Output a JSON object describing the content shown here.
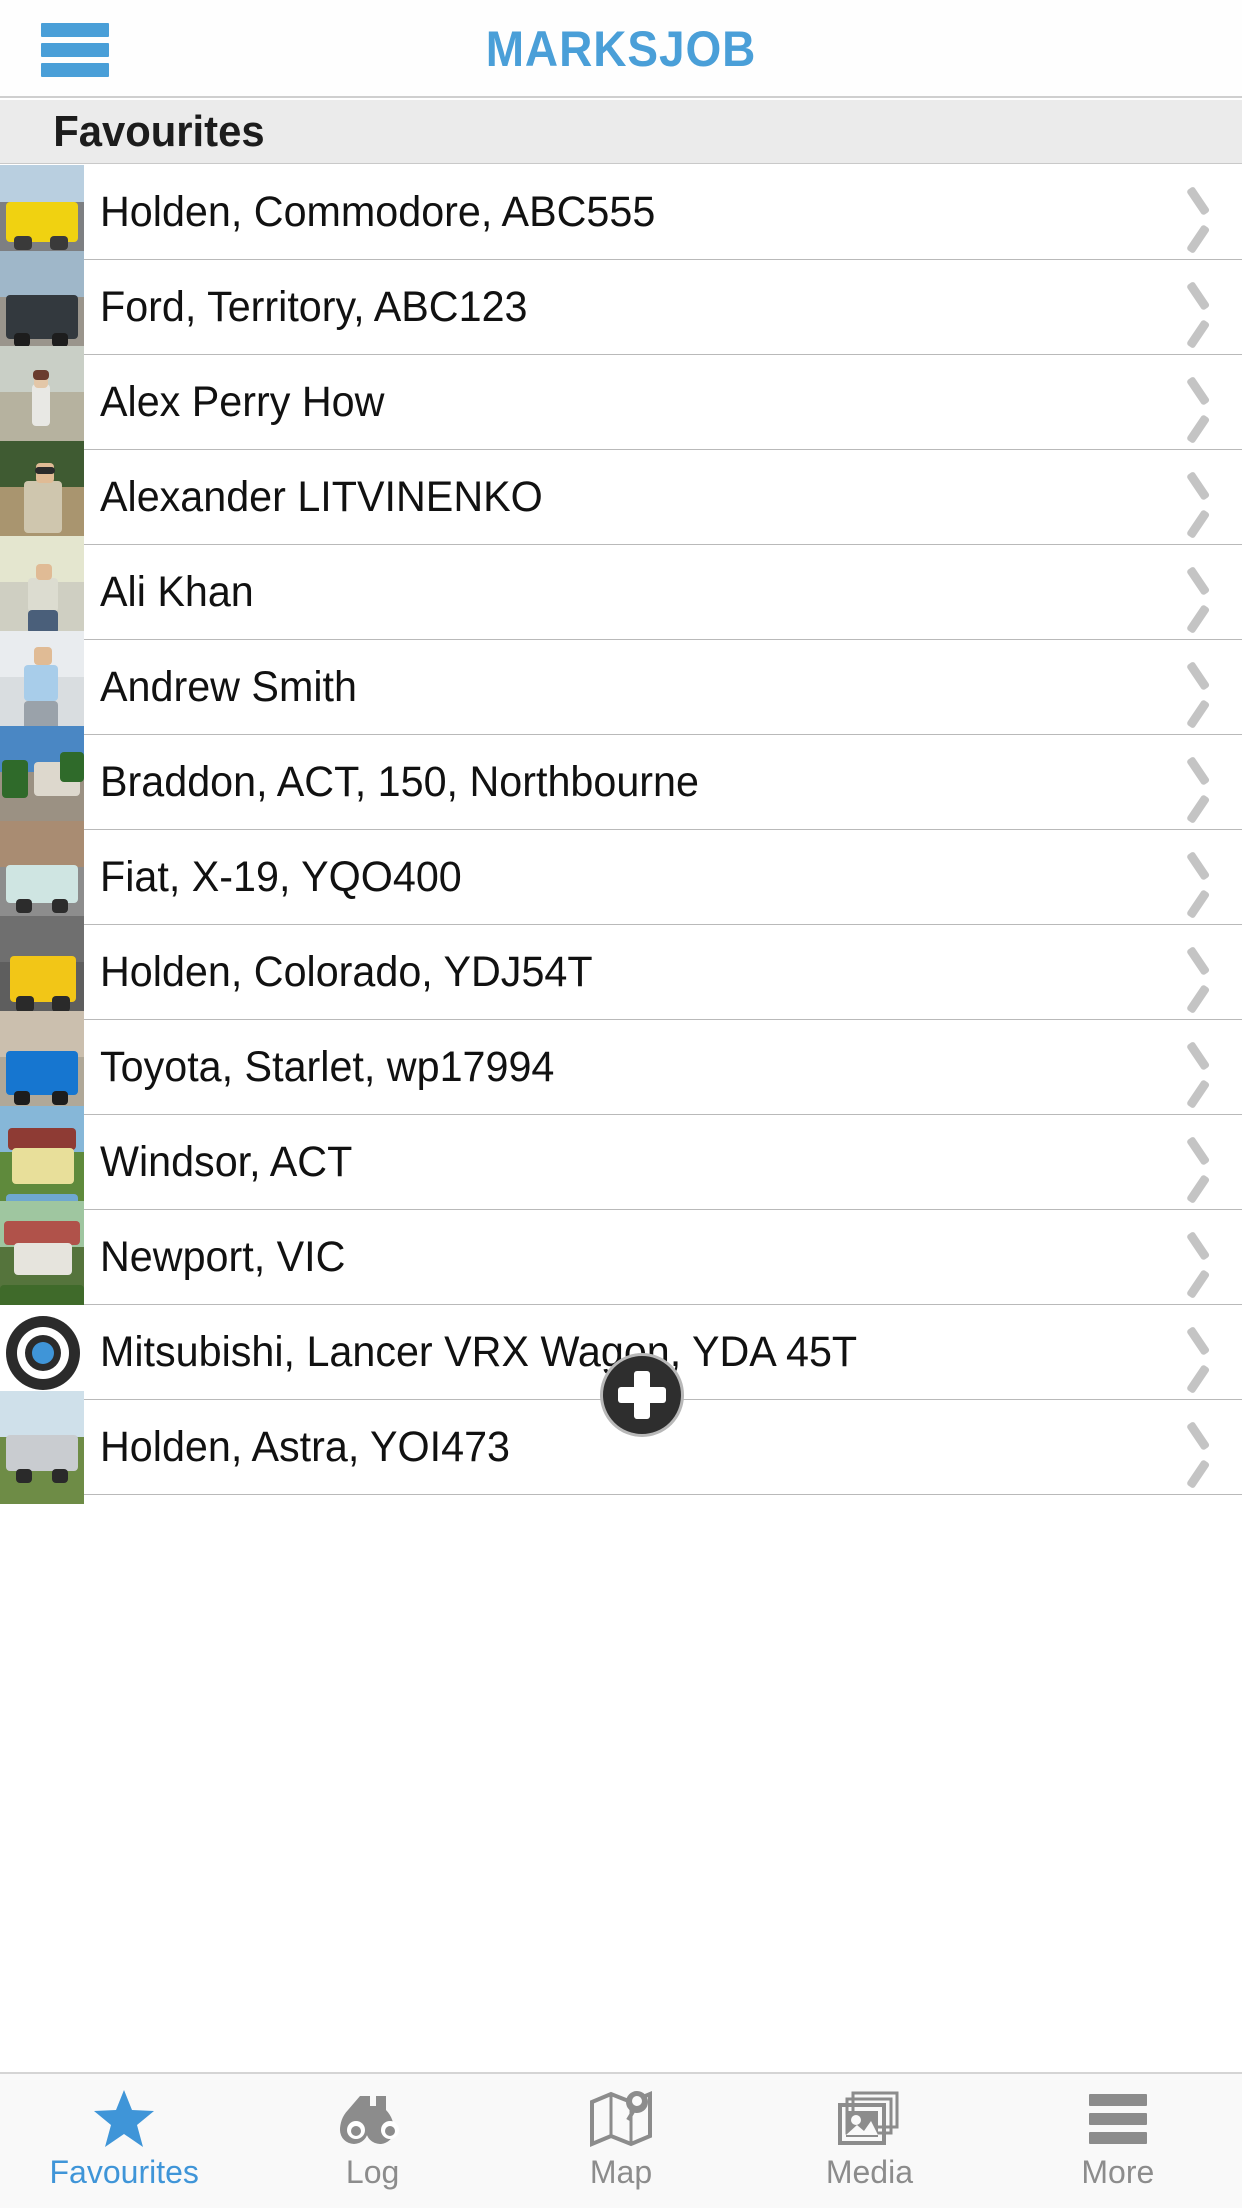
{
  "navbar": {
    "title": "MARKSJOB",
    "menu_icon": "hamburger-menu-icon",
    "title_color": "#4a9fd8"
  },
  "section": {
    "header": "Favourites"
  },
  "list": {
    "rows": [
      {
        "label": "Holden, Commodore, ABC555",
        "thumb": "car-yellow-sedan",
        "accessory": "chevron-right-icon"
      },
      {
        "label": "Ford, Territory, ABC123",
        "thumb": "car-dark-suv",
        "accessory": "chevron-right-icon"
      },
      {
        "label": "Alex Perry How",
        "thumb": "person-woman-standing",
        "accessory": "chevron-right-icon"
      },
      {
        "label": "Alexander LITVINENKO",
        "thumb": "person-man-sunglasses",
        "accessory": "chevron-right-icon"
      },
      {
        "label": "Ali Khan",
        "thumb": "person-man-seated",
        "accessory": "chevron-right-icon"
      },
      {
        "label": "Andrew Smith",
        "thumb": "person-man-railing",
        "accessory": "chevron-right-icon"
      },
      {
        "label": "Braddon, ACT, 150, Northbourne",
        "thumb": "building-street",
        "accessory": "chevron-right-icon"
      },
      {
        "label": "Fiat, X-19, YQO400",
        "thumb": "car-white-fiat",
        "accessory": "chevron-right-icon"
      },
      {
        "label": "Holden, Colorado, YDJ54T",
        "thumb": "car-yellow-suv",
        "accessory": "chevron-right-icon"
      },
      {
        "label": "Toyota, Starlet, wp17994",
        "thumb": "car-blue-hatch",
        "accessory": "chevron-right-icon"
      },
      {
        "label": "Windsor, ACT",
        "thumb": "house-yellow",
        "accessory": "chevron-right-icon"
      },
      {
        "label": "Newport, VIC",
        "thumb": "house-red",
        "accessory": "chevron-right-icon"
      },
      {
        "label": "Mitsubishi, Lancer VRX Wagon, YDA 45T",
        "thumb": "bullseye-target-icon",
        "accessory": "chevron-right-icon"
      },
      {
        "label": "Holden, Astra, YOI473",
        "thumb": "car-silver-sedan",
        "accessory": "chevron-right-icon"
      }
    ]
  },
  "fab": {
    "icon": "plus-icon",
    "label": "Add",
    "color": "#2e2e2e"
  },
  "tabbar": {
    "active_color": "#3f95d8",
    "inactive_color": "#8c8c8c",
    "tabs": [
      {
        "label": "Favourites",
        "icon": "star-icon",
        "active": true
      },
      {
        "label": "Log",
        "icon": "binoculars-icon",
        "active": false
      },
      {
        "label": "Map",
        "icon": "map-icon",
        "active": false
      },
      {
        "label": "Media",
        "icon": "photos-stack-icon",
        "active": false
      },
      {
        "label": "More",
        "icon": "hamburger-menu-icon",
        "active": false
      }
    ]
  }
}
